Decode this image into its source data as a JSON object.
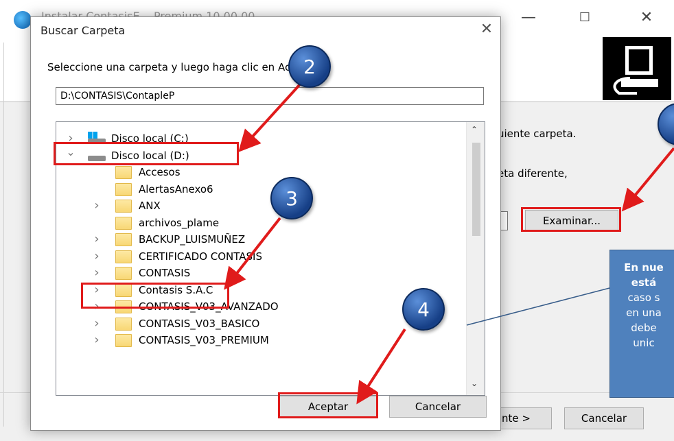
{
  "background_window": {
    "title": "Instalar ContasisE... Premium 10.00.00",
    "caption_buttons": [
      "—",
      "☐",
      "✕"
    ],
    "text_line1": "uiente carpeta.",
    "text_line2": "eta diferente,",
    "browse_button": "Examinar...",
    "next_button": "nte >",
    "cancel_button": "Cancelar"
  },
  "dialog": {
    "title": "Buscar Carpeta",
    "close_glyph": "✕",
    "prompt": "Seleccione una carpeta y luego haga clic en Aceptar.",
    "path_value": "D:\\CONTASIS\\ContapleP",
    "tree": [
      {
        "label": "Disco local (C:)",
        "icon": "windows-drive-icon",
        "level": 0,
        "expander": "collapsed"
      },
      {
        "label": "Disco local (D:)",
        "icon": "drive-icon",
        "level": 0,
        "expander": "expanded"
      },
      {
        "label": "Accesos",
        "icon": "folder-icon",
        "level": 1,
        "expander": "none"
      },
      {
        "label": "AlertasAnexo6",
        "icon": "folder-icon",
        "level": 1,
        "expander": "none"
      },
      {
        "label": "ANX",
        "icon": "folder-icon",
        "level": 1,
        "expander": "collapsed"
      },
      {
        "label": "archivos_plame",
        "icon": "folder-icon",
        "level": 1,
        "expander": "none"
      },
      {
        "label": "BACKUP_LUISMUÑEZ",
        "icon": "folder-icon",
        "level": 1,
        "expander": "collapsed"
      },
      {
        "label": "CERTIFICADO CONTASIS",
        "icon": "folder-icon",
        "level": 1,
        "expander": "collapsed"
      },
      {
        "label": "CONTASIS",
        "icon": "folder-icon",
        "level": 1,
        "expander": "collapsed",
        "selected": true
      },
      {
        "label": "Contasis S.A.C",
        "icon": "folder-icon",
        "level": 1,
        "expander": "collapsed"
      },
      {
        "label": "CONTASIS_V03_AVANZADO",
        "icon": "folder-icon",
        "level": 1,
        "expander": "collapsed"
      },
      {
        "label": "CONTASIS_V03_BASICO",
        "icon": "folder-icon",
        "level": 1,
        "expander": "collapsed"
      },
      {
        "label": "CONTASIS_V03_PREMIUM",
        "icon": "folder-icon",
        "level": 1,
        "expander": "collapsed"
      }
    ],
    "ok_button": "Aceptar",
    "cancel_button": "Cancelar"
  },
  "annotations": {
    "steps": [
      "2",
      "3",
      "4"
    ],
    "callout_lines": [
      "En nue",
      "está",
      "caso s",
      "en una",
      "debe",
      "unic"
    ],
    "highlight_color": "#e01b1b",
    "callout_color": "#4f81bd"
  }
}
